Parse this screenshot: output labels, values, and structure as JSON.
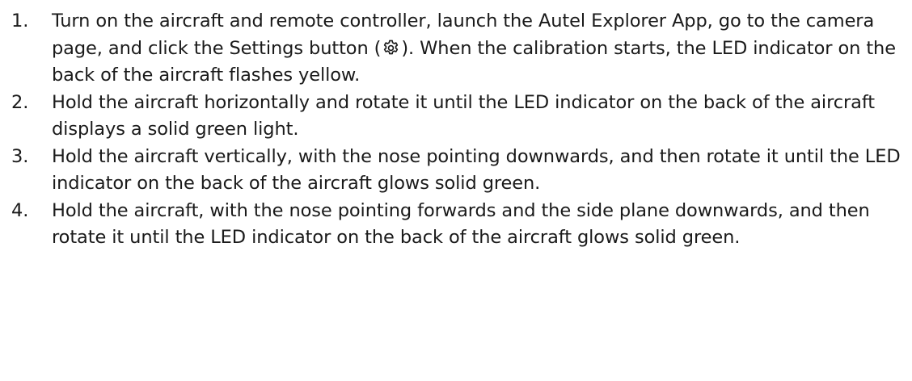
{
  "steps": [
    {
      "number": "1.",
      "text_before_icon": "Turn on the aircraft and remote controller, launch the Autel Explorer App, go to the camera page, and click the Settings button (",
      "icon": "gear-icon",
      "text_after_icon": "). When the calibration starts, the LED indicator on the back of the aircraft flashes yellow."
    },
    {
      "number": "2.",
      "text": "Hold the aircraft horizontally and rotate it until the LED indicator on the back of the aircraft displays a solid green light."
    },
    {
      "number": "3.",
      "text": "Hold the aircraft vertically, with the nose pointing downwards, and then rotate it until the LED indicator on the back of the aircraft glows solid green."
    },
    {
      "number": "4.",
      "text": "Hold the aircraft, with the nose pointing forwards and the side plane downwards, and then rotate it until the LED indicator on the back of the aircraft glows solid green."
    }
  ],
  "colors": {
    "text": "#1a1a1a",
    "background": "#ffffff"
  }
}
